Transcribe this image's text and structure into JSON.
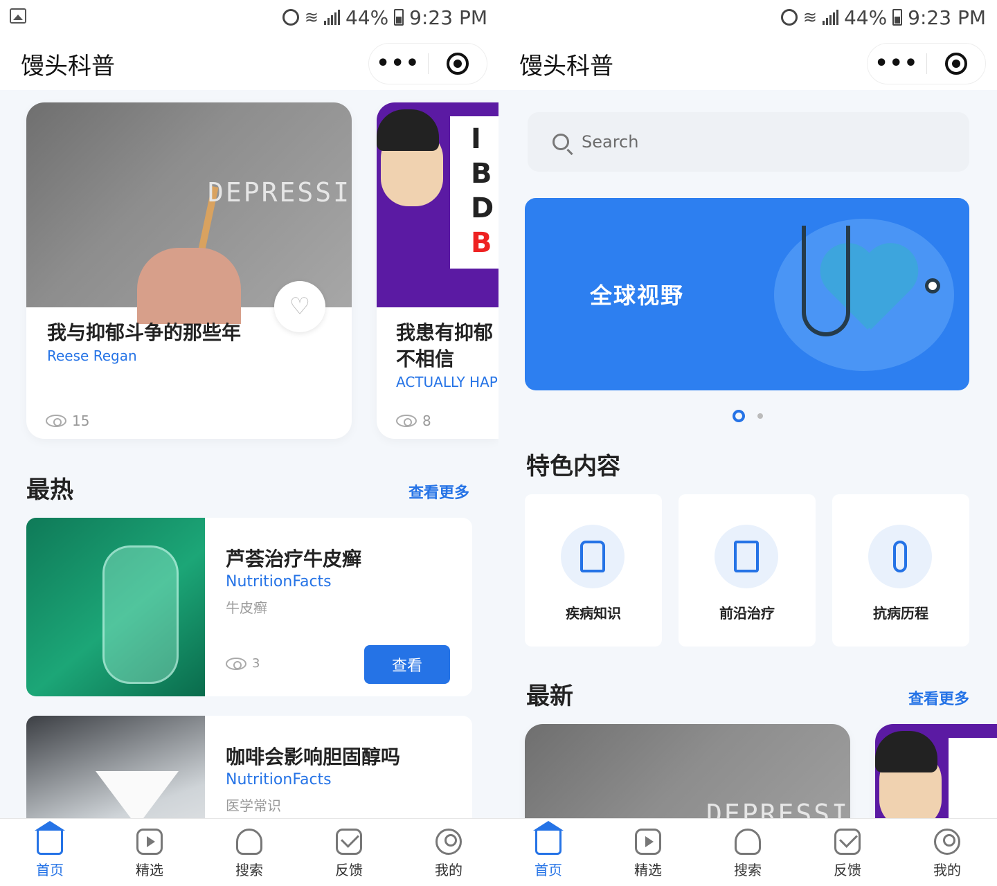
{
  "status": {
    "battery": "44%",
    "time": "9:23 PM"
  },
  "app": {
    "title": "馒头科普",
    "menu_label": "•••"
  },
  "left": {
    "featured": [
      {
        "title": "我与抑郁斗争的那些年",
        "author": "Reese Regan",
        "views": "15",
        "image_text": "DEPRESSION"
      },
      {
        "title": "我患有抑郁不相信",
        "author": "ACTUALLY HAPPY",
        "views": "8"
      }
    ],
    "hot_section": {
      "title": "最热",
      "more": "查看更多"
    },
    "hot_items": [
      {
        "title": "芦荟治疗牛皮癣",
        "author": "NutritionFacts",
        "tag": "牛皮癣",
        "views": "3",
        "button": "查看"
      },
      {
        "title": "咖啡会影响胆固醇吗",
        "author": "NutritionFacts",
        "tag": "医学常识"
      }
    ]
  },
  "right": {
    "search": {
      "placeholder": "Search"
    },
    "banner": {
      "text": "全球视野",
      "slide_count": 2,
      "active_slide": 1
    },
    "featured_section": {
      "title": "特色内容"
    },
    "features": [
      {
        "label": "疾病知识",
        "icon": "microscope-icon"
      },
      {
        "label": "前沿治疗",
        "icon": "treatment-icon"
      },
      {
        "label": "抗病历程",
        "icon": "person-icon"
      }
    ],
    "latest_section": {
      "title": "最新",
      "more": "查看更多",
      "image_text": "DEPRESSION"
    }
  },
  "tabbar": {
    "items": [
      {
        "label": "首页",
        "icon": "home-icon",
        "active": true
      },
      {
        "label": "精选",
        "icon": "video-icon",
        "active": false
      },
      {
        "label": "搜索",
        "icon": "stethoscope-icon",
        "active": false
      },
      {
        "label": "反馈",
        "icon": "feedback-icon",
        "active": false
      },
      {
        "label": "我的",
        "icon": "user-icon",
        "active": false
      }
    ]
  },
  "colors": {
    "accent": "#2573e6",
    "banner": "#2d7ff0",
    "background": "#f4f7fb"
  }
}
